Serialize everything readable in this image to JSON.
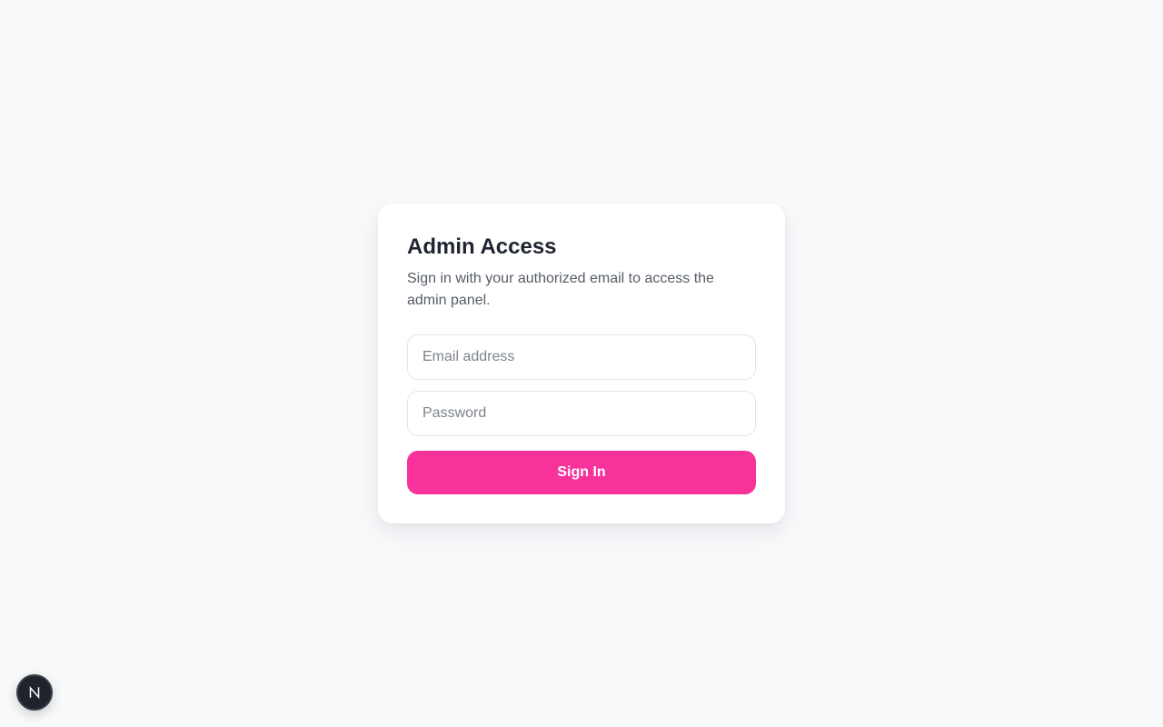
{
  "login": {
    "title": "Admin Access",
    "subtitle": "Sign in with your authorized email to access the admin panel.",
    "email_placeholder": "Email address",
    "email_value": "",
    "password_placeholder": "Password",
    "password_value": "",
    "submit_label": "Sign In"
  },
  "dev_badge": {
    "icon": "nextjs-logo-icon",
    "letter": "N"
  },
  "colors": {
    "background": "#f8f9fb",
    "card": "#ffffff",
    "accent": "#f7339b",
    "title": "#1f2430",
    "subtitle": "#555c67",
    "input_border": "#e4e6ea",
    "badge": "#1f232b"
  }
}
